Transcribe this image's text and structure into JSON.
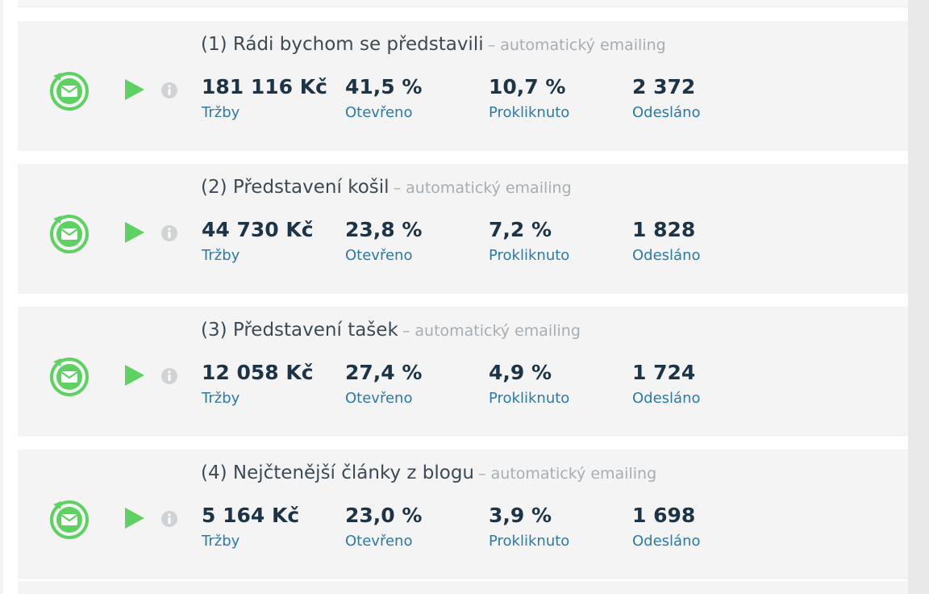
{
  "campaigns": [
    {
      "title": "(1) Rádi bychom se představili",
      "suffix": "– automatický emailing",
      "stats": [
        {
          "value": "181 116 Kč",
          "label": "Tržby"
        },
        {
          "value": "41,5 %",
          "label": "Otevřeno"
        },
        {
          "value": "10,7 %",
          "label": "Prokliknuto"
        },
        {
          "value": "2 372",
          "label": "Odesláno"
        }
      ]
    },
    {
      "title": "(2) Představení košil",
      "suffix": "– automatický emailing",
      "stats": [
        {
          "value": "44 730 Kč",
          "label": "Tržby"
        },
        {
          "value": "23,8 %",
          "label": "Otevřeno"
        },
        {
          "value": "7,2 %",
          "label": "Prokliknuto"
        },
        {
          "value": "1 828",
          "label": "Odesláno"
        }
      ]
    },
    {
      "title": "(3) Představení tašek",
      "suffix": "– automatický emailing",
      "stats": [
        {
          "value": "12 058 Kč",
          "label": "Tržby"
        },
        {
          "value": "27,4 %",
          "label": "Otevřeno"
        },
        {
          "value": "4,9 %",
          "label": "Prokliknuto"
        },
        {
          "value": "1 724",
          "label": "Odesláno"
        }
      ]
    },
    {
      "title": "(4) Nejčtenější články z blogu",
      "suffix": "– automatický emailing",
      "stats": [
        {
          "value": "5 164 Kč",
          "label": "Tržby"
        },
        {
          "value": "23,0 %",
          "label": "Otevřeno"
        },
        {
          "value": "3,9 %",
          "label": "Prokliknuto"
        },
        {
          "value": "1 698",
          "label": "Odesláno"
        }
      ]
    }
  ],
  "icons": {
    "status": "automated-email-icon",
    "play": "play-icon",
    "info": "info-icon"
  },
  "colors": {
    "accent_green": "#5fd163",
    "value_text": "#1d3346",
    "label_link": "#2b7aa8",
    "muted": "#a7aeb3",
    "row_bg": "#f4f4f4"
  }
}
